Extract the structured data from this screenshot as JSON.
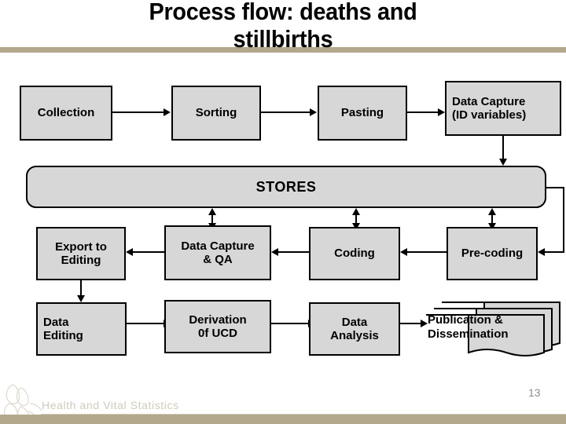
{
  "slide": {
    "title": "Process flow: deaths and\nstillbirths",
    "page_number": "13",
    "footer_text": "Health and Vital Statistics",
    "accent_color": "#b3a88c",
    "box_fill_color": "#d7d7d7",
    "box_border_color": "#000000"
  },
  "row1": {
    "collection": "Collection",
    "sorting": "Sorting",
    "pasting": "Pasting",
    "data_capture_id": "Data Capture\n(ID variables)"
  },
  "stores": {
    "label": "STORES"
  },
  "row3": {
    "export_to_editing": "Export to\nEditing",
    "data_capture_qa": "Data Capture\n& QA",
    "coding": "Coding",
    "pre_coding": "Pre-coding"
  },
  "row4": {
    "data_editing": "Data\nEditing",
    "derivation_ucd": "Derivation\n0f UCD",
    "data_analysis": "Data\nAnalysis",
    "publication": "Publication &\nDissemination"
  }
}
